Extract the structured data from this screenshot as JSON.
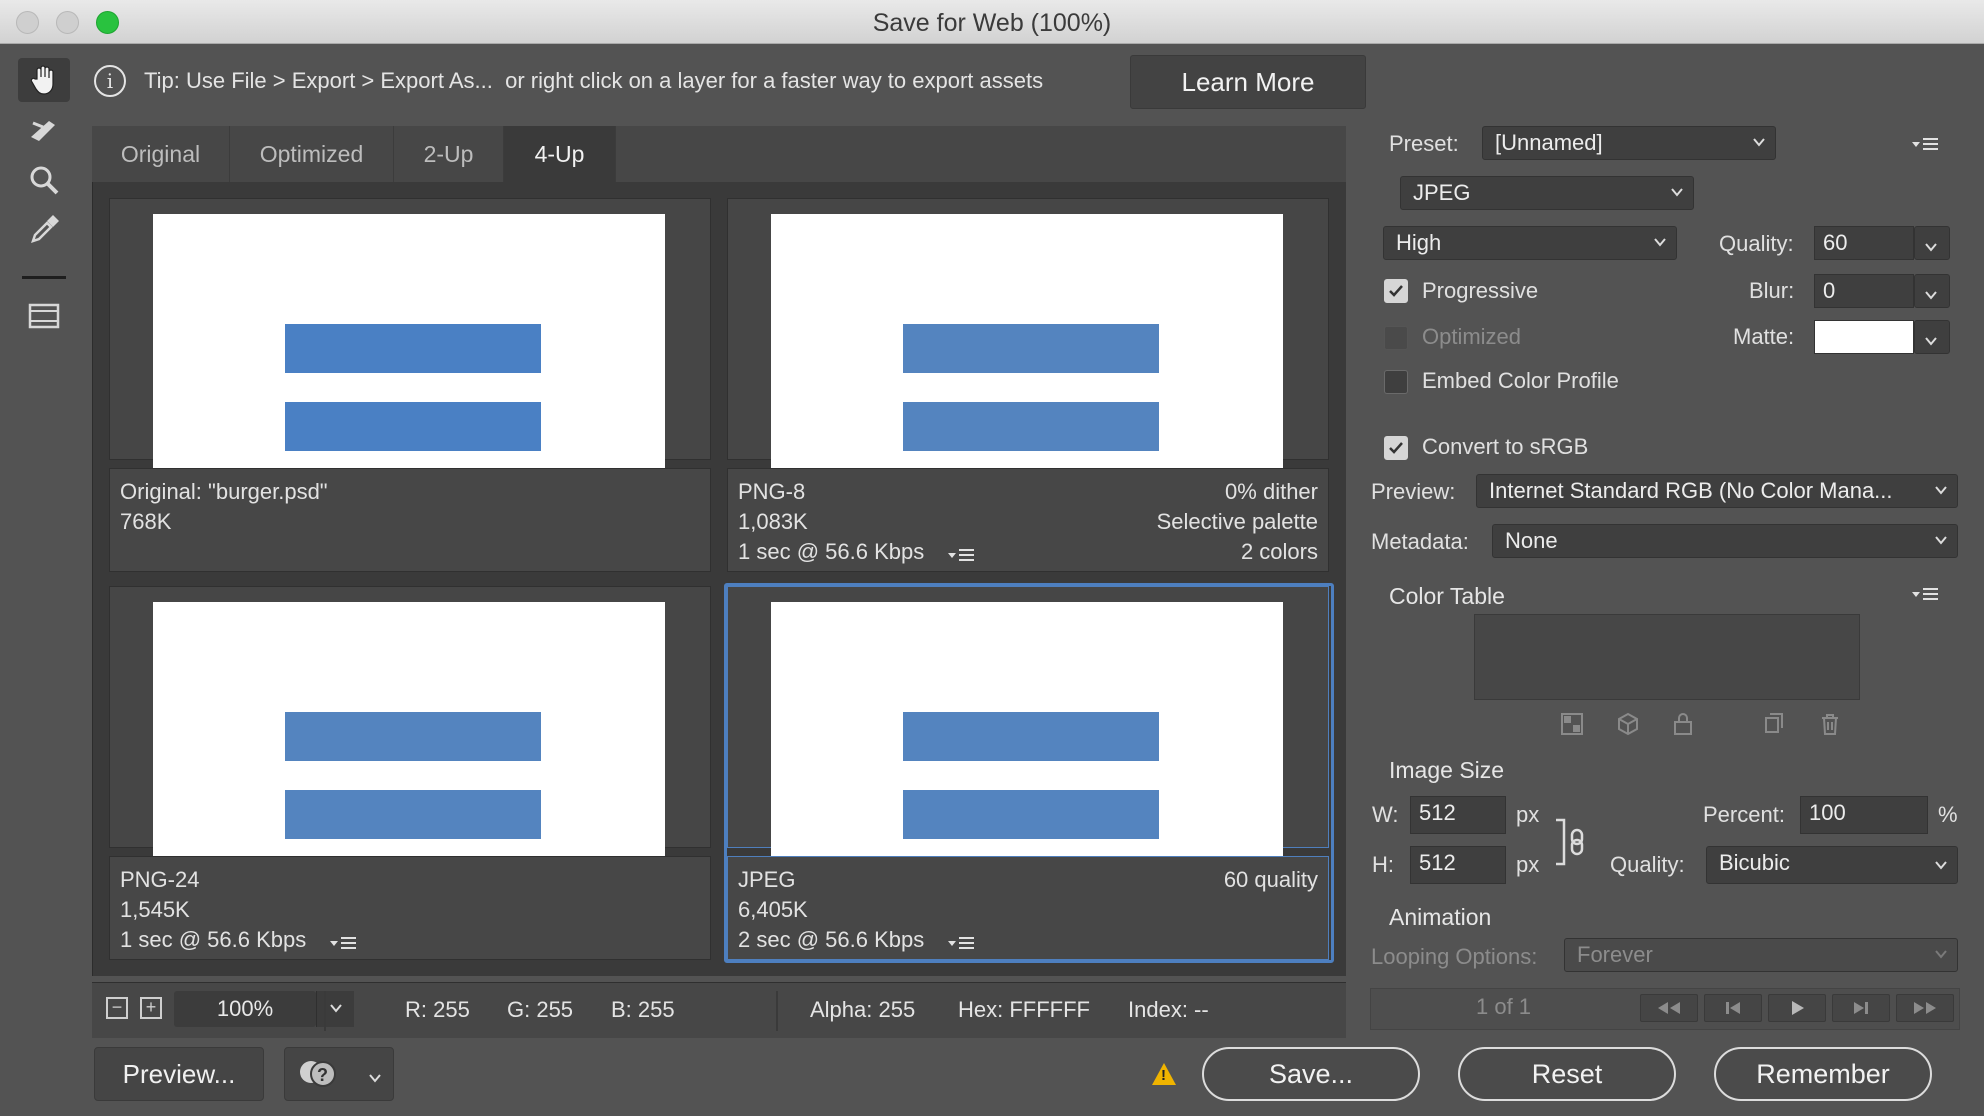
{
  "window": {
    "title": "Save for Web (100%)"
  },
  "tip": {
    "text": "Tip: Use File > Export > Export As...  or right click on a layer for a faster way to export assets",
    "learn_more": "Learn More"
  },
  "tabs": [
    {
      "label": "Original"
    },
    {
      "label": "Optimized"
    },
    {
      "label": "2-Up"
    },
    {
      "label": "4-Up"
    }
  ],
  "panes": {
    "original": {
      "line1": "Original: \"burger.psd\"",
      "line2": "768K"
    },
    "png8": {
      "format": "PNG-8",
      "size": "1,083K",
      "time": "1 sec @ 56.6 Kbps",
      "dither": "0% dither",
      "palette": "Selective palette",
      "colors": "2 colors"
    },
    "png24": {
      "format": "PNG-24",
      "size": "1,545K",
      "time": "1 sec @ 56.6 Kbps"
    },
    "jpeg": {
      "format": "JPEG",
      "size": "6,405K",
      "time": "2 sec @ 56.6 Kbps",
      "quality": "60 quality"
    }
  },
  "status": {
    "zoom": "100%",
    "r": "R: 255",
    "g": "G: 255",
    "b": "B: 255",
    "alpha": "Alpha: 255",
    "hex": "Hex: FFFFFF",
    "index": "Index: --"
  },
  "buttons": {
    "preview": "Preview...",
    "save": "Save...",
    "reset": "Reset",
    "remember": "Remember"
  },
  "settings": {
    "preset_label": "Preset:",
    "preset_value": "[Unnamed]",
    "format": "JPEG",
    "quality_level": "High",
    "quality_label": "Quality:",
    "quality_value": "60",
    "progressive": "Progressive",
    "blur_label": "Blur:",
    "blur_value": "0",
    "optimized": "Optimized",
    "matte_label": "Matte:",
    "embed_profile": "Embed Color Profile",
    "convert_srgb": "Convert to sRGB",
    "preview_label": "Preview:",
    "preview_value": "Internet Standard RGB (No Color Mana...",
    "metadata_label": "Metadata:",
    "metadata_value": "None",
    "color_table": "Color Table",
    "image_size": "Image Size",
    "w_label": "W:",
    "w_value": "512",
    "h_label": "H:",
    "h_value": "512",
    "px": "px",
    "percent_label": "Percent:",
    "percent_value": "100",
    "percent_sign": "%",
    "resample_label": "Quality:",
    "resample_value": "Bicubic",
    "animation": "Animation",
    "looping_label": "Looping Options:",
    "looping_value": "Forever",
    "frame_counter": "1 of 1"
  },
  "colors": {
    "accent": "#4d7fc0",
    "bar_blue": "#5484bf",
    "maximize_green": "#29c23f",
    "warning": "#f0b400"
  }
}
